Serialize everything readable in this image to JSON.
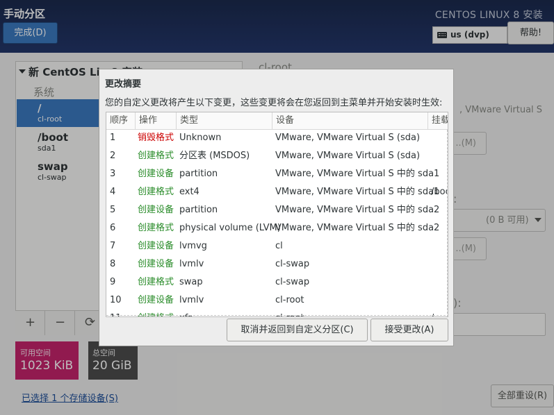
{
  "header": {
    "page_title": "手动分区",
    "done_label": "完成(D)",
    "product_title": "CENTOS LINUX 8 安装",
    "keyboard_layout": "us (dvp)",
    "help_label": "帮助!"
  },
  "background": {
    "tree_header": "新 CentOS Lin    8 安装",
    "tree_system": "系统",
    "items": [
      {
        "name": "/",
        "sub": "cl-root"
      },
      {
        "name": "/boot",
        "sub": "sda1"
      },
      {
        "name": "swap",
        "sub": "cl-swap"
      }
    ],
    "toolbar": {
      "add": "+",
      "remove": "−",
      "refresh": "⟳"
    },
    "available_label": "可用空间",
    "available_value": "1023 KiB",
    "total_label": "总空间",
    "total_value": "20 GiB",
    "storage_link": "已选择 1 个存储设备(S)",
    "reset_label": "全部重设(R)",
    "right_title": "cl-root",
    "right_device": ", VMware Virtual S",
    "right_btn1": "..(M)",
    "right_colon1": ":",
    "right_combo": "(0 B 可用)",
    "right_btn2": "..(M)",
    "right_colon2": "):"
  },
  "dialog": {
    "title": "更改摘要",
    "description": "您的自定义更改将产生以下变更，这些变更将会在您返回到主菜单并开始安装时生效:",
    "columns": [
      "顺序",
      "操作",
      "类型",
      "设备",
      "挂载"
    ],
    "rows": [
      {
        "order": "1",
        "action": "销毁格式",
        "action_kind": "destroy",
        "type": "Unknown",
        "device": "VMware, VMware Virtual S (sda)",
        "mount": ""
      },
      {
        "order": "2",
        "action": "创建格式",
        "action_kind": "create",
        "type": "分区表 (MSDOS)",
        "device": "VMware, VMware Virtual S (sda)",
        "mount": ""
      },
      {
        "order": "3",
        "action": "创建设备",
        "action_kind": "create",
        "type": "partition",
        "device": "VMware, VMware Virtual S 中的 sda1",
        "mount": ""
      },
      {
        "order": "4",
        "action": "创建格式",
        "action_kind": "create",
        "type": "ext4",
        "device": "VMware, VMware Virtual S 中的 sda1",
        "mount": "/boot"
      },
      {
        "order": "5",
        "action": "创建设备",
        "action_kind": "create",
        "type": "partition",
        "device": "VMware, VMware Virtual S 中的 sda2",
        "mount": ""
      },
      {
        "order": "6",
        "action": "创建格式",
        "action_kind": "create",
        "type": "physical volume (LVM)",
        "device": "VMware, VMware Virtual S 中的 sda2",
        "mount": ""
      },
      {
        "order": "7",
        "action": "创建设备",
        "action_kind": "create",
        "type": "lvmvg",
        "device": "cl",
        "mount": ""
      },
      {
        "order": "8",
        "action": "创建设备",
        "action_kind": "create",
        "type": "lvmlv",
        "device": "cl-swap",
        "mount": ""
      },
      {
        "order": "9",
        "action": "创建格式",
        "action_kind": "create",
        "type": "swap",
        "device": "cl-swap",
        "mount": ""
      },
      {
        "order": "10",
        "action": "创建设备",
        "action_kind": "create",
        "type": "lvmlv",
        "device": "cl-root",
        "mount": ""
      },
      {
        "order": "11",
        "action": "创建格式",
        "action_kind": "create",
        "type": "xfs",
        "device": "cl-root",
        "mount": "/"
      }
    ],
    "cancel_label": "取消并返回到自定义分区(C)",
    "accept_label": "接受更改(A)"
  },
  "colors": {
    "destroy": "#cc0000",
    "create": "#2a8c2a",
    "selection": "#3a78bf",
    "available_bg": "#c4246b",
    "total_bg": "#4c4c4c"
  }
}
